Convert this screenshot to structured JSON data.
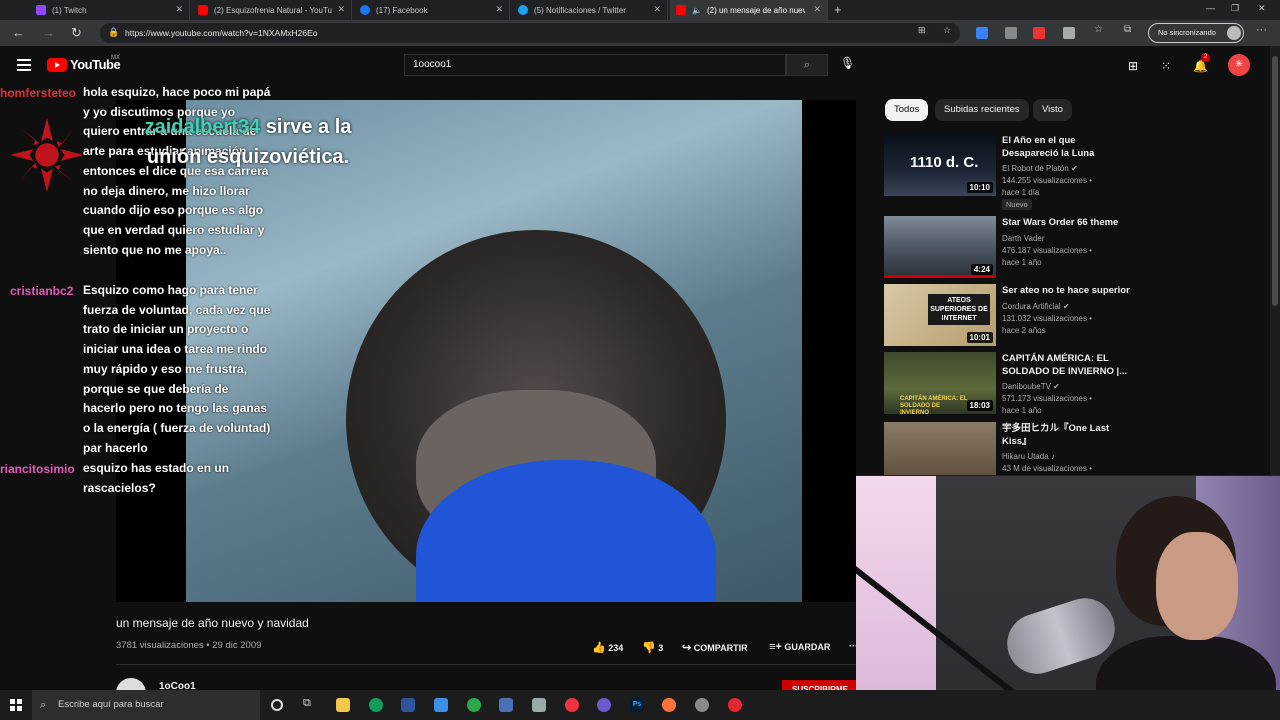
{
  "browser": {
    "tabs": [
      {
        "label": "(1) Twitch",
        "color": "#9146ff"
      },
      {
        "label": "(2) Esquizofrenia Natural - YouTube",
        "color": "#ff0000"
      },
      {
        "label": "(17) Facebook",
        "color": "#1877f2"
      },
      {
        "label": "(5) Notificaciones / Twitter",
        "color": "#1da1f2"
      },
      {
        "label": "(2) un mensaje de año nuevo",
        "color": "#ff0000"
      }
    ],
    "url": "https://www.youtube.com/watch?v=1NXAMxH26Eo",
    "sync_label": "No sincronizando"
  },
  "youtube": {
    "logo_text": "YouTube",
    "region": "MX",
    "search_value": "1oocoo1",
    "notification_count": "2"
  },
  "chat": [
    {
      "user": "homfersteteo",
      "color": "#e03030",
      "message": "hola esquizo, hace poco mi papá y yo discutimos porque yo quiero entrar a una escuela de arte para estudiar animación entonces el dice que esa carrera no deja dinero, me hizo llorar cuando dijo eso porque es algo que en verdad quiero estudiar y siento que no me apoya.."
    },
    {
      "user": "cristianbc2",
      "color": "#e05cb8",
      "message": "Esquizo como hago para tener fuerza de voluntad, cada vez que trato de iniciar un proyecto o iniciar una idea o tarea me rindo muy rápido y eso me frustra, porque se que debería de hacerlo pero no tengo las ganas o la energía ( fuerza de voluntad) par hacerlo"
    },
    {
      "user": "riancitosimio",
      "color": "#e05cb8",
      "message": "esquizo has estado en un rascacielos?"
    }
  ],
  "alert": {
    "user": "zaidalbert34",
    "text": "sirve a la unión esquizoviética."
  },
  "video": {
    "title": "un mensaje de año nuevo y navidad",
    "meta": "3781 visualizaciones • 29 dic 2009",
    "likes": "234",
    "dislikes": "3",
    "share_label": "COMPARTIR",
    "save_label": "GUARDAR",
    "channel": "1oCoo1",
    "subscribe_label": "SUSCRIBIRME"
  },
  "chips": [
    "Todos",
    "Subidas recientes",
    "Visto"
  ],
  "recommendations": [
    {
      "title": "El Año en el que Desapareció la Luna",
      "channel": "El Robot de Platón",
      "views": "144.255 visualizaciones •",
      "age": "hace 1 día",
      "duration": "10:10",
      "badge": "Nuevo",
      "thumb_text": "1110 d. C."
    },
    {
      "title": "Star Wars Order 66 theme",
      "channel": "Darth Vader",
      "views": "476.187 visualizaciones •",
      "age": "hace 1 año",
      "duration": "4:24"
    },
    {
      "title": "Ser ateo no te hace superior",
      "channel": "Cordura Artificial",
      "views": "131.032 visualizaciones •",
      "age": "hace 2 años",
      "duration": "10:01",
      "thumb_text": "ATEOS SUPERIORES DE INTERNET"
    },
    {
      "title": "CAPITÁN AMÉRICA: EL SOLDADO DE INVIERNO |...",
      "channel": "DaniboubeTV",
      "views": "571.173 visualizaciones •",
      "age": "hace 1 año",
      "duration": "18:03",
      "thumb_text": "CAPITÁN AMÉRICA: EL SOLDADO DE INVIERNO"
    },
    {
      "title": "宇多田ヒカル『One Last Kiss』",
      "channel": "Hikaru Utada",
      "views": "43 M de visualizaciones •",
      "age": "",
      "duration": ""
    }
  ],
  "taskbar": {
    "search_placeholder": "Escribe aquí para buscar"
  }
}
